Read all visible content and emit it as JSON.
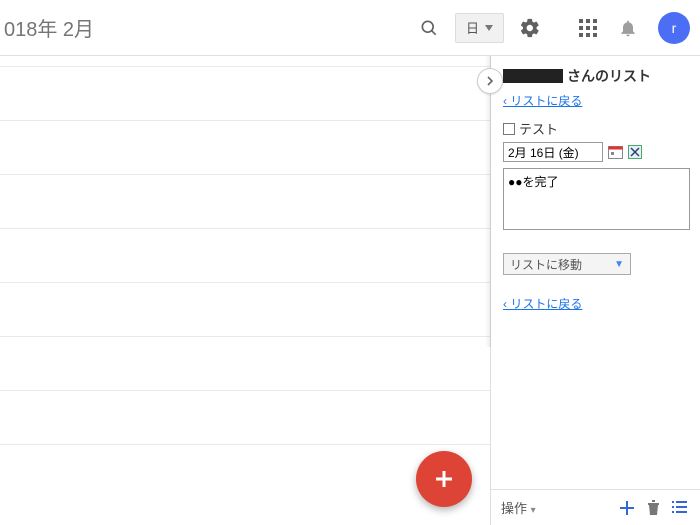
{
  "header": {
    "title": "018年 2月",
    "view_label": "日",
    "avatar_letter": "r"
  },
  "task_panel": {
    "list_title_suffix": "さんのリスト",
    "back_link": "‹ リストに戻る",
    "task_name": "テスト",
    "date_value": "2月 16日 (金)",
    "note_value": "●●を完了",
    "move_select_label": "リストに移動",
    "back_link2": "‹ リストに戻る",
    "footer_action": "操作",
    "footer_caret": "▾"
  }
}
